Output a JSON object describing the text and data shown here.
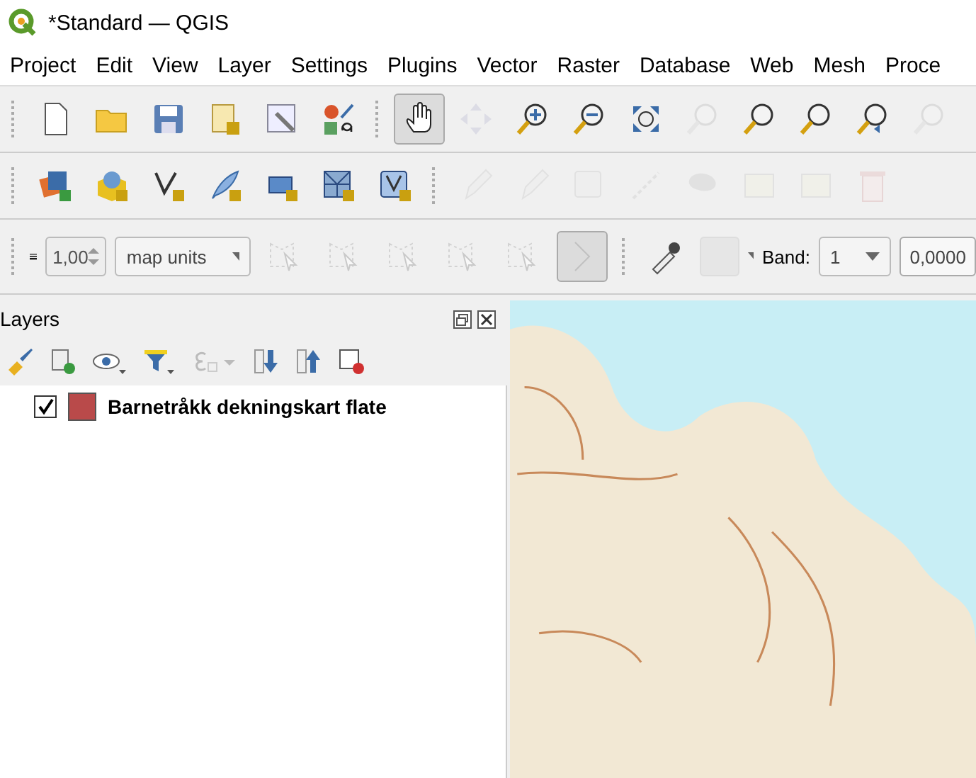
{
  "window": {
    "title": "*Standard — QGIS"
  },
  "menu": [
    "Project",
    "Edit",
    "View",
    "Layer",
    "Settings",
    "Plugins",
    "Vector",
    "Raster",
    "Database",
    "Web",
    "Mesh",
    "Proce"
  ],
  "toolbar_1": [
    {
      "disabled": false,
      "selected": false
    },
    {
      "disabled": false,
      "selected": false
    },
    {
      "disabled": false,
      "selected": false
    },
    {
      "disabled": false,
      "selected": false
    },
    {
      "disabled": false,
      "selected": false
    },
    {
      "disabled": false,
      "selected": false
    },
    {
      "disabled": false,
      "selected": true
    },
    {
      "disabled": true,
      "selected": false
    },
    {
      "disabled": false,
      "selected": false
    },
    {
      "disabled": false,
      "selected": false
    },
    {
      "disabled": false,
      "selected": false
    },
    {
      "disabled": true,
      "selected": false
    },
    {
      "disabled": false,
      "selected": false
    },
    {
      "disabled": false,
      "selected": false
    },
    {
      "disabled": false,
      "selected": false
    },
    {
      "disabled": true,
      "selected": false
    }
  ],
  "toolbar_2": [
    {
      "disabled": false
    },
    {
      "disabled": false
    },
    {
      "disabled": false
    },
    {
      "disabled": false
    },
    {
      "disabled": false
    },
    {
      "disabled": false
    },
    {
      "disabled": false
    },
    {
      "disabled": true
    },
    {
      "disabled": true
    },
    {
      "disabled": true
    },
    {
      "disabled": true
    },
    {
      "disabled": true
    },
    {
      "disabled": true
    },
    {
      "disabled": true
    },
    {
      "disabled": true
    }
  ],
  "toolbar_3": {
    "width_value": "1,00",
    "unit": "map units",
    "band_label": "Band:",
    "band": "1",
    "value": "0,0000"
  },
  "layers_panel": {
    "title": "Layers",
    "layers": [
      {
        "name": "Barnetråkk dekningskart flate",
        "checked": true,
        "color": "#b94a4a"
      }
    ]
  }
}
